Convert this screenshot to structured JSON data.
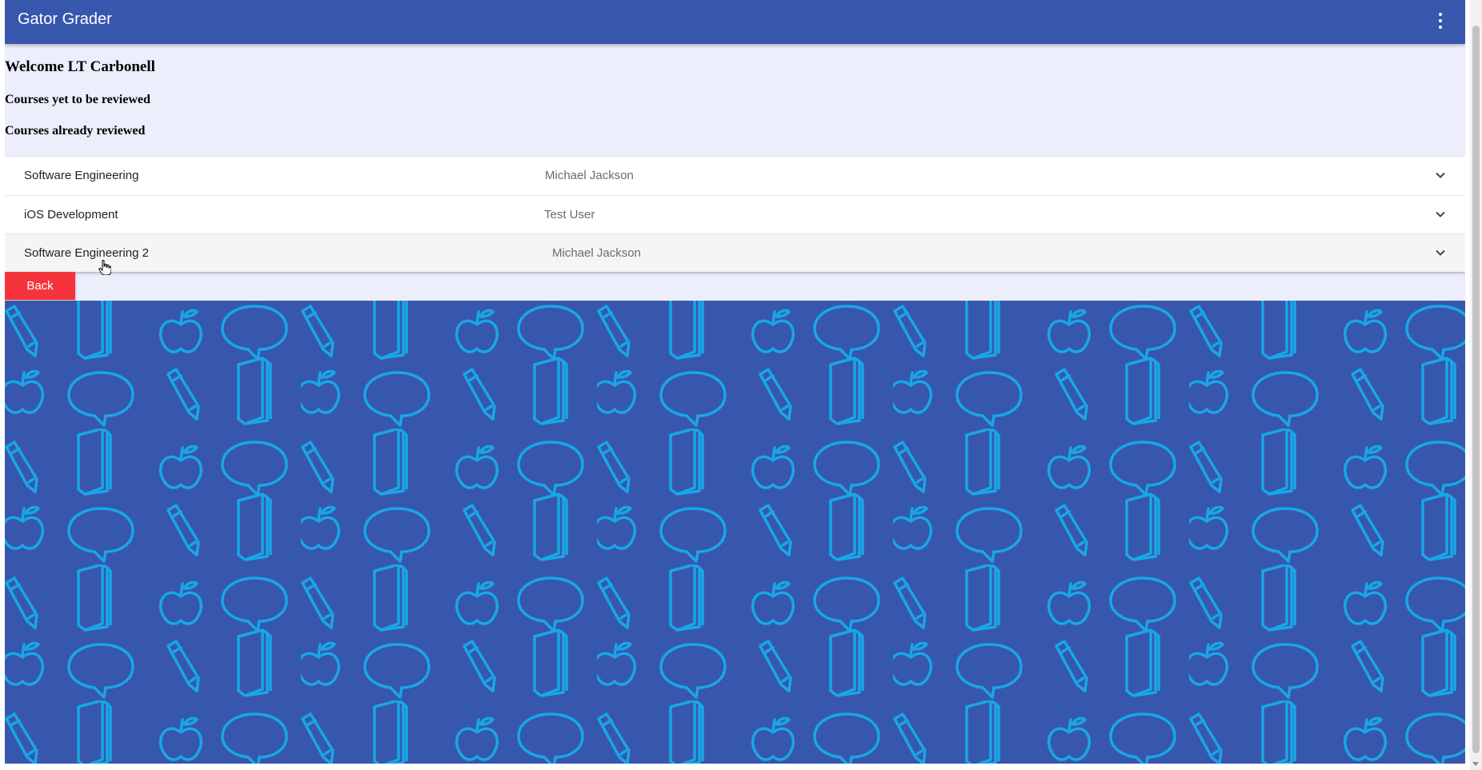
{
  "app": {
    "title": "Gator Grader",
    "menu_icon": "more-vert-icon"
  },
  "headings": {
    "welcome": "Welcome LT Carbonell",
    "pending": "Courses yet to be reviewed",
    "reviewed": "Courses already reviewed"
  },
  "courses": [
    {
      "title": "Software Engineering",
      "instructor": "Michael Jackson"
    },
    {
      "title": "iOS Development",
      "instructor": "Test User"
    },
    {
      "title": "Software Engineering 2",
      "instructor": "Michael Jackson"
    }
  ],
  "actions": {
    "back_label": "Back"
  },
  "colors": {
    "toolbar": "#3757ad",
    "page_bg": "#eceefc",
    "back_button": "#f4333c",
    "pattern_bg": "#3757ad",
    "pattern_stroke": "#18a7e6"
  }
}
